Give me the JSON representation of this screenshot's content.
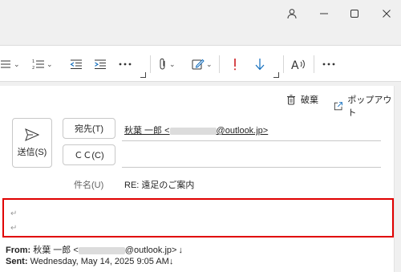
{
  "titlebar": {
    "icons": [
      "person-icon",
      "minimize-icon",
      "maximize-icon",
      "close-icon"
    ]
  },
  "ribbon": {
    "tools": [
      "bullets-icon",
      "numbering-icon",
      "decrease-indent-icon",
      "increase-indent-icon",
      "more-icon",
      "attach-icon",
      "signature-icon",
      "high-importance-icon",
      "low-importance-icon",
      "read-aloud-icon",
      "more-options-icon"
    ],
    "importance_color": "#d13438",
    "low_importance_color": "#0f6cbd"
  },
  "compose": {
    "discard_label": "破棄",
    "popout_label": "ポップアウト",
    "send_label": "送信(S)",
    "to_label": "宛先(T)",
    "cc_label": "ＣＣ(C)",
    "to_value_name": "秋葉 一郎 <",
    "to_value_domain": "@outlook.jp>",
    "subject_label": "件名(U)",
    "subject_value": "RE: 遠足のご案内",
    "paragraph_mark": "↵"
  },
  "quoted": {
    "from_label": "From:",
    "from_name": "秋葉 一郎 <",
    "from_domain": "@outlook.jp>",
    "from_mark": "↓",
    "sent_label": "Sent:",
    "sent_value": "Wednesday, May 14, 2025 9:05 AM",
    "sent_mark": "↓"
  },
  "highlight_color": "#e00000"
}
